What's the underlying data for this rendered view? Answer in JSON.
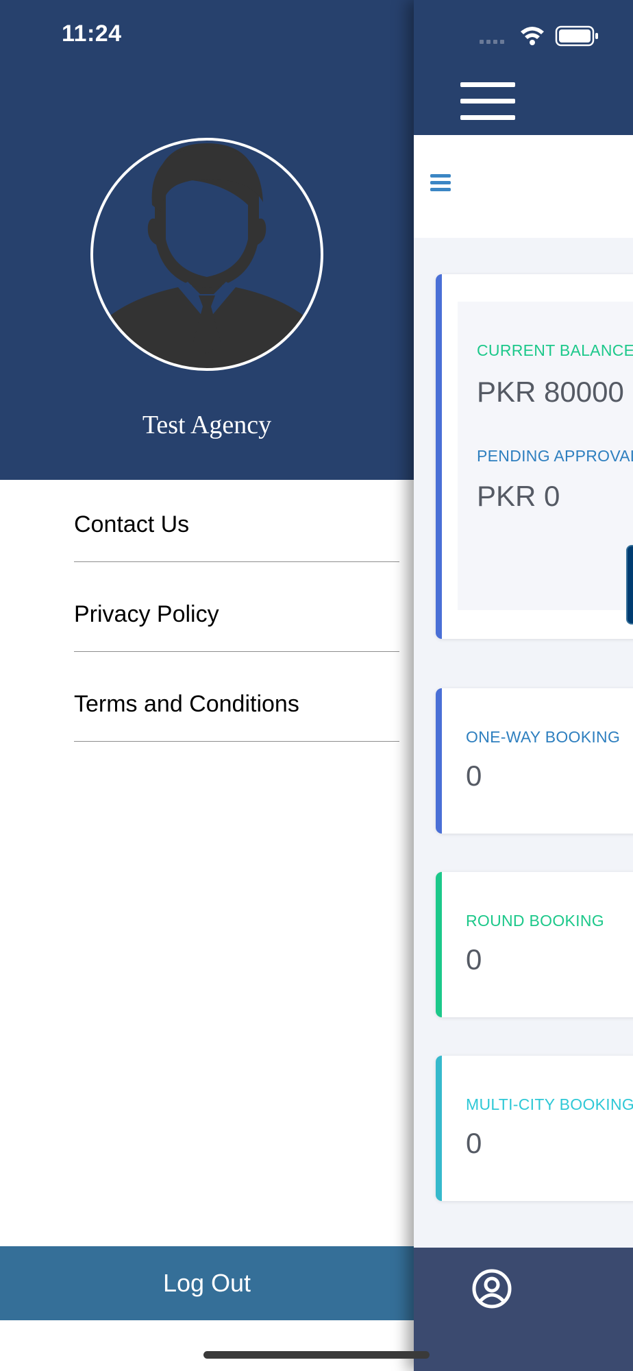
{
  "status_bar": {
    "time": "11:24"
  },
  "drawer": {
    "agency_name": "Test Agency",
    "menu": [
      {
        "label": "Contact Us"
      },
      {
        "label": "Privacy Policy"
      },
      {
        "label": "Terms and Conditions"
      }
    ],
    "logout_label": "Log Out"
  },
  "dashboard": {
    "balance": {
      "current_label": "CURRENT BALANCE",
      "current_value": "PKR 80000",
      "pending_label": "PENDING APPROVAL",
      "pending_value": "PKR 0",
      "add_symbol": "+"
    },
    "bookings": [
      {
        "label": "ONE-WAY BOOKING",
        "value": "0",
        "accent": "#4a6fd6"
      },
      {
        "label": "ROUND BOOKING",
        "value": "0",
        "accent": "#1cc88a"
      },
      {
        "label": "MULTI-CITY BOOKING",
        "value": "0",
        "accent": "#36b9cc"
      }
    ]
  },
  "colors": {
    "header_bg": "#27416d",
    "logout_bg": "#356f98",
    "bottom_bar_bg": "#3b4a6f",
    "balance_accent": "#4a6fd6",
    "current_label_color": "#1cc88a",
    "pending_label_color": "#2e7fbf",
    "add_button_bg": "#003c71"
  },
  "icons": {
    "signal": "signal-icon",
    "wifi": "wifi-icon",
    "battery": "battery-icon",
    "menu": "hamburger-icon",
    "profile": "user-circle-icon",
    "avatar": "user-avatar-icon"
  }
}
